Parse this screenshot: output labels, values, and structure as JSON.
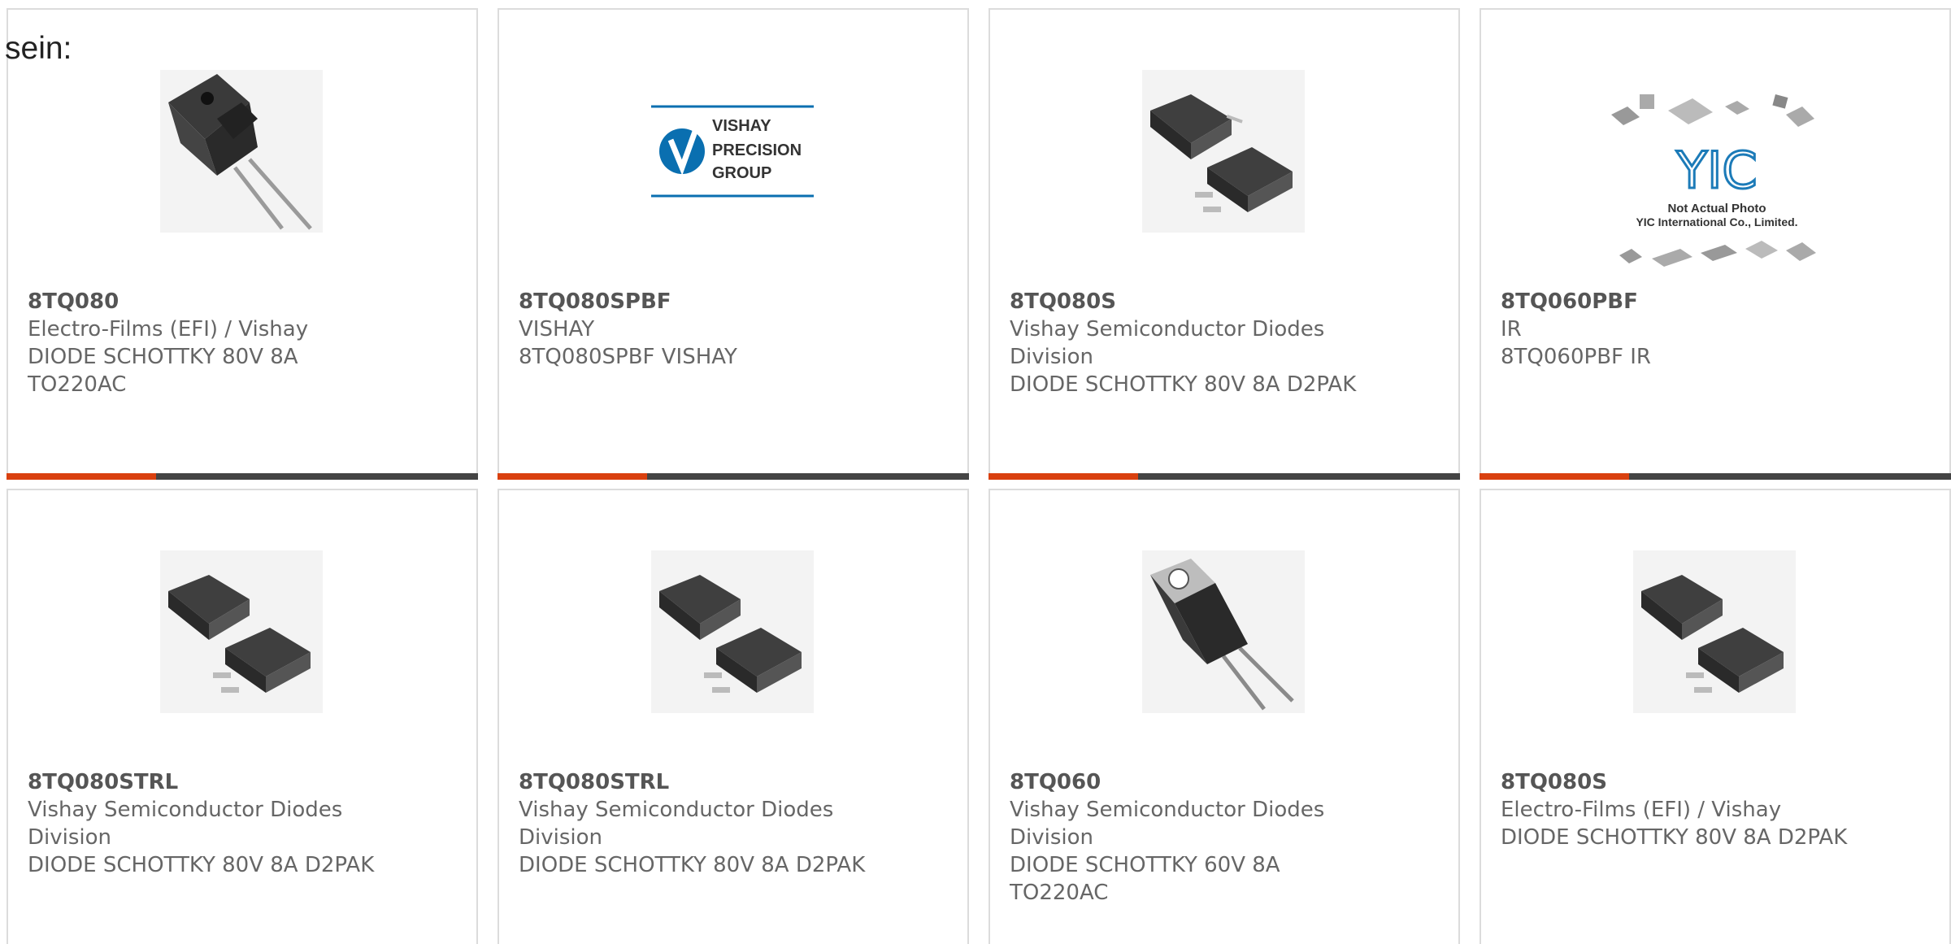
{
  "intro_text": "sein:",
  "products": [
    {
      "pn": "8TQ080",
      "mfr": "Electro-Films (EFI) / Vishay",
      "desc": "DIODE SCHOTTKY 80V 8A",
      "desc2": "TO220AC",
      "image": "to220-fullpak-photo"
    },
    {
      "pn": "8TQ080SPBF",
      "mfr": "VISHAY",
      "desc": "8TQ080SPBF VISHAY",
      "desc2": "",
      "image": "vishay-precision-group-logo",
      "logo": {
        "line1": "VISHAY",
        "line2": "PRECISION",
        "line3": "GROUP"
      }
    },
    {
      "pn": "8TQ080S",
      "mfr": "Vishay Semiconductor Diodes",
      "mfr2": "Division",
      "desc": "DIODE SCHOTTKY 80V 8A D2PAK",
      "image": "d2pak-photo"
    },
    {
      "pn": "8TQ060PBF",
      "mfr": "IR",
      "desc": "8TQ060PBF IR",
      "desc2": "",
      "image": "yic-placeholder",
      "placeholder": {
        "logo": "YIC",
        "line1": "Not Actual Photo",
        "line2": "YIC International Co., Limited."
      }
    },
    {
      "pn": "8TQ080STRL",
      "mfr": "Vishay Semiconductor Diodes",
      "mfr2": "Division",
      "desc": "DIODE SCHOTTKY 80V 8A D2PAK",
      "image": "d2pak-photo"
    },
    {
      "pn": "8TQ080STRL",
      "mfr": "Vishay Semiconductor Diodes",
      "mfr2": "Division",
      "desc": "DIODE SCHOTTKY 80V 8A D2PAK",
      "image": "d2pak-photo"
    },
    {
      "pn": "8TQ060",
      "mfr": "Vishay Semiconductor Diodes",
      "mfr2": "Division",
      "desc": "DIODE SCHOTTKY 60V 8A",
      "desc2": "TO220AC",
      "image": "to220ac-photo"
    },
    {
      "pn": "8TQ080S",
      "mfr": "Electro-Films (EFI) / Vishay",
      "desc": "DIODE SCHOTTKY 80V 8A D2PAK",
      "desc2": "",
      "image": "d2pak-photo"
    }
  ],
  "colors": {
    "accent": "#d9400f",
    "bar": "#444444",
    "border": "#dcdcdc",
    "vishay_blue": "#0a6fb0"
  }
}
